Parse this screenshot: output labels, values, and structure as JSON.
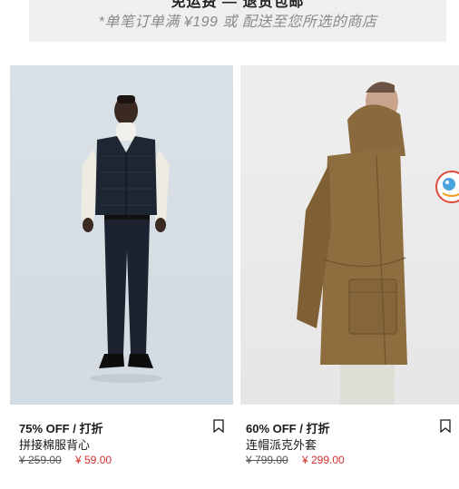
{
  "banner": {
    "title": "免运费 — 退货包邮",
    "subtitle": "*单笔订单满 ¥199  或  配送至您所选的商店"
  },
  "products": [
    {
      "discount": "75% OFF / 打折",
      "name": "拼接棉服背心",
      "old_price": "¥ 259.00",
      "new_price": "¥ 59.00",
      "image": "model-wearing-quilted-vest",
      "bookmark_icon": "bookmark-icon"
    },
    {
      "discount": "60% OFF / 打折",
      "name": "连帽派克外套",
      "old_price": "¥ 799.00",
      "new_price": "¥ 299.00",
      "image": "model-wearing-hooded-parka",
      "bookmark_icon": "bookmark-icon"
    }
  ],
  "colors": {
    "sale_red": "#d0312d",
    "banner_bg": "#efefef",
    "text": "#1a1a1a"
  }
}
